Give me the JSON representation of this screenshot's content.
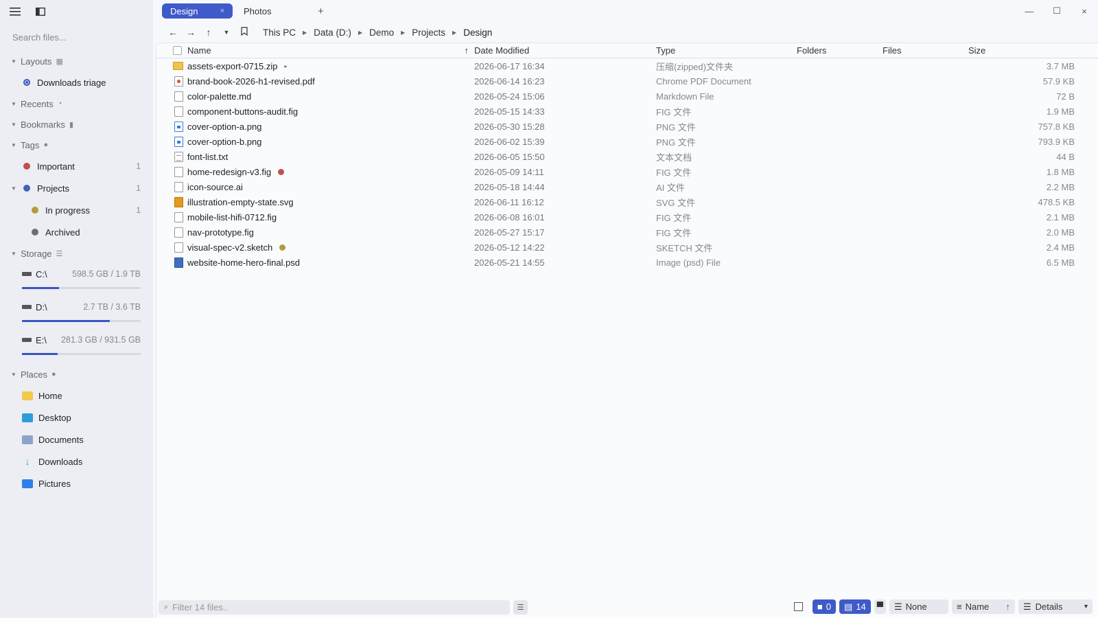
{
  "sidebar": {
    "search_placeholder": "Search files...",
    "sections": {
      "layouts": "Layouts",
      "recents": "Recents",
      "bookmarks": "Bookmarks",
      "tags": "Tags",
      "storage": "Storage",
      "places": "Places"
    },
    "layouts_items": [
      {
        "label": "Downloads triage"
      }
    ],
    "tags": [
      {
        "label": "Important",
        "count": "1",
        "color": "#c0504d"
      },
      {
        "label": "Projects",
        "count": "1",
        "color": "#3f63b8"
      },
      {
        "label": "In progress",
        "count": "1",
        "color": "#b59a3c"
      },
      {
        "label": "Archived",
        "count": "",
        "color": "#6b6f78"
      }
    ],
    "drives": [
      {
        "label": "C:\\",
        "size": "598.5 GB / 1.9 TB",
        "used_fraction": 0.31
      },
      {
        "label": "D:\\",
        "size": "2.7 TB / 3.6 TB",
        "used_fraction": 0.74
      },
      {
        "label": "E:\\",
        "size": "281.3 GB / 931.5 GB",
        "used_fraction": 0.3
      }
    ],
    "places": [
      {
        "label": "Home",
        "icon": "home-folder-icon",
        "color": "#f2c94c"
      },
      {
        "label": "Desktop",
        "icon": "desktop-icon",
        "color": "#2d9cdb"
      },
      {
        "label": "Documents",
        "icon": "documents-icon",
        "color": "#8fa3c8"
      },
      {
        "label": "Downloads",
        "icon": "downloads-icon",
        "color": "#27ae9a"
      },
      {
        "label": "Pictures",
        "icon": "pictures-icon",
        "color": "#2f80ed"
      }
    ]
  },
  "tabs": [
    {
      "label": "Design",
      "close": "×"
    },
    {
      "label": "Photos"
    }
  ],
  "new_tab": "+",
  "window": {
    "minimize": "—",
    "maximize": "☐",
    "close": "×"
  },
  "breadcrumb": [
    "This PC",
    "Data (D:)",
    "Demo",
    "Projects",
    "Design"
  ],
  "columns": {
    "name": "Name",
    "sort_arrow": "↑",
    "date": "Date Modified",
    "type": "Type",
    "folders": "Folders",
    "files": "Files",
    "size": "Size"
  },
  "files": [
    {
      "name": "assets-export-0715.zip",
      "date": "2026-06-17 16:34",
      "type": "压缩(zipped)文件夹",
      "size": "3.7 MB",
      "icon": "zip",
      "tag": "",
      "expand": "▸"
    },
    {
      "name": "brand-book-2026-h1-revised.pdf",
      "date": "2026-06-14 16:23",
      "type": "Chrome PDF Document",
      "size": "57.9 KB",
      "icon": "pdf",
      "tag": ""
    },
    {
      "name": "color-palette.md",
      "date": "2026-05-24 15:06",
      "type": "Markdown File",
      "size": "72 B",
      "icon": "doc",
      "tag": ""
    },
    {
      "name": "component-buttons-audit.fig",
      "date": "2026-05-15 14:33",
      "type": "FIG 文件",
      "size": "1.9 MB",
      "icon": "doc",
      "tag": ""
    },
    {
      "name": "cover-option-a.png",
      "date": "2026-05-30 15:28",
      "type": "PNG 文件",
      "size": "757.8 KB",
      "icon": "png",
      "tag": ""
    },
    {
      "name": "cover-option-b.png",
      "date": "2026-06-02 15:39",
      "type": "PNG 文件",
      "size": "793.9 KB",
      "icon": "png",
      "tag": ""
    },
    {
      "name": "font-list.txt",
      "date": "2026-06-05 15:50",
      "type": "文本文档",
      "size": "44 B",
      "icon": "txt",
      "tag": ""
    },
    {
      "name": "home-redesign-v3.fig",
      "date": "2026-05-09 14:11",
      "type": "FIG 文件",
      "size": "1.8 MB",
      "icon": "doc",
      "tag": "#c0504d"
    },
    {
      "name": "icon-source.ai",
      "date": "2026-05-18 14:44",
      "type": "AI 文件",
      "size": "2.2 MB",
      "icon": "doc",
      "tag": ""
    },
    {
      "name": "illustration-empty-state.svg",
      "date": "2026-06-11 16:12",
      "type": "SVG 文件",
      "size": "478.5 KB",
      "icon": "svg",
      "tag": ""
    },
    {
      "name": "mobile-list-hifi-0712.fig",
      "date": "2026-06-08 16:01",
      "type": "FIG 文件",
      "size": "2.1 MB",
      "icon": "doc",
      "tag": ""
    },
    {
      "name": "nav-prototype.fig",
      "date": "2026-05-27 15:17",
      "type": "FIG 文件",
      "size": "2.0 MB",
      "icon": "doc",
      "tag": ""
    },
    {
      "name": "visual-spec-v2.sketch",
      "date": "2026-05-12 14:22",
      "type": "SKETCH 文件",
      "size": "2.4 MB",
      "icon": "doc",
      "tag": "#b59a3c"
    },
    {
      "name": "website-home-hero-final.psd",
      "date": "2026-05-21 14:55",
      "type": "Image (psd) File",
      "size": "6.5 MB",
      "icon": "psd",
      "tag": ""
    }
  ],
  "statusbar": {
    "filter_placeholder": "Filter 14 files..",
    "folders_count": "0",
    "files_count": "14",
    "group_by": "None",
    "sort_by": "Name",
    "sort_dir": "↑",
    "view": "Details",
    "view_caret": "▾"
  },
  "colors": {
    "accent": "#3f5ac9"
  }
}
